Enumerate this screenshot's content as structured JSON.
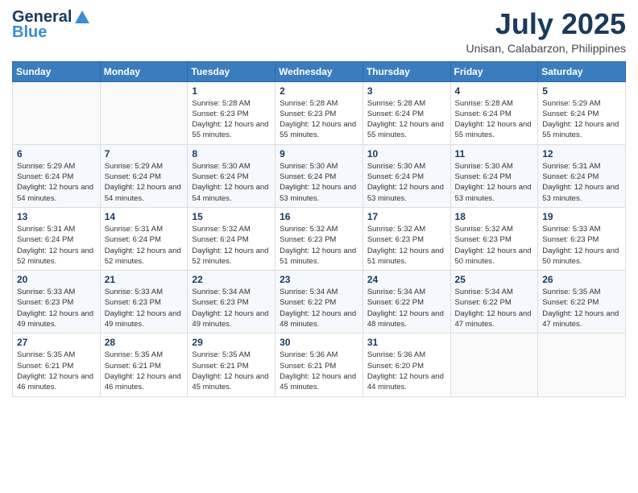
{
  "logo": {
    "general": "General",
    "blue": "Blue"
  },
  "header": {
    "month": "July 2025",
    "location": "Unisan, Calabarzon, Philippines"
  },
  "weekdays": [
    "Sunday",
    "Monday",
    "Tuesday",
    "Wednesday",
    "Thursday",
    "Friday",
    "Saturday"
  ],
  "weeks": [
    [
      {
        "day": "",
        "sunrise": "",
        "sunset": "",
        "daylight": ""
      },
      {
        "day": "",
        "sunrise": "",
        "sunset": "",
        "daylight": ""
      },
      {
        "day": "1",
        "sunrise": "Sunrise: 5:28 AM",
        "sunset": "Sunset: 6:23 PM",
        "daylight": "Daylight: 12 hours and 55 minutes."
      },
      {
        "day": "2",
        "sunrise": "Sunrise: 5:28 AM",
        "sunset": "Sunset: 6:23 PM",
        "daylight": "Daylight: 12 hours and 55 minutes."
      },
      {
        "day": "3",
        "sunrise": "Sunrise: 5:28 AM",
        "sunset": "Sunset: 6:24 PM",
        "daylight": "Daylight: 12 hours and 55 minutes."
      },
      {
        "day": "4",
        "sunrise": "Sunrise: 5:28 AM",
        "sunset": "Sunset: 6:24 PM",
        "daylight": "Daylight: 12 hours and 55 minutes."
      },
      {
        "day": "5",
        "sunrise": "Sunrise: 5:29 AM",
        "sunset": "Sunset: 6:24 PM",
        "daylight": "Daylight: 12 hours and 55 minutes."
      }
    ],
    [
      {
        "day": "6",
        "sunrise": "Sunrise: 5:29 AM",
        "sunset": "Sunset: 6:24 PM",
        "daylight": "Daylight: 12 hours and 54 minutes."
      },
      {
        "day": "7",
        "sunrise": "Sunrise: 5:29 AM",
        "sunset": "Sunset: 6:24 PM",
        "daylight": "Daylight: 12 hours and 54 minutes."
      },
      {
        "day": "8",
        "sunrise": "Sunrise: 5:30 AM",
        "sunset": "Sunset: 6:24 PM",
        "daylight": "Daylight: 12 hours and 54 minutes."
      },
      {
        "day": "9",
        "sunrise": "Sunrise: 5:30 AM",
        "sunset": "Sunset: 6:24 PM",
        "daylight": "Daylight: 12 hours and 53 minutes."
      },
      {
        "day": "10",
        "sunrise": "Sunrise: 5:30 AM",
        "sunset": "Sunset: 6:24 PM",
        "daylight": "Daylight: 12 hours and 53 minutes."
      },
      {
        "day": "11",
        "sunrise": "Sunrise: 5:30 AM",
        "sunset": "Sunset: 6:24 PM",
        "daylight": "Daylight: 12 hours and 53 minutes."
      },
      {
        "day": "12",
        "sunrise": "Sunrise: 5:31 AM",
        "sunset": "Sunset: 6:24 PM",
        "daylight": "Daylight: 12 hours and 53 minutes."
      }
    ],
    [
      {
        "day": "13",
        "sunrise": "Sunrise: 5:31 AM",
        "sunset": "Sunset: 6:24 PM",
        "daylight": "Daylight: 12 hours and 52 minutes."
      },
      {
        "day": "14",
        "sunrise": "Sunrise: 5:31 AM",
        "sunset": "Sunset: 6:24 PM",
        "daylight": "Daylight: 12 hours and 52 minutes."
      },
      {
        "day": "15",
        "sunrise": "Sunrise: 5:32 AM",
        "sunset": "Sunset: 6:24 PM",
        "daylight": "Daylight: 12 hours and 52 minutes."
      },
      {
        "day": "16",
        "sunrise": "Sunrise: 5:32 AM",
        "sunset": "Sunset: 6:23 PM",
        "daylight": "Daylight: 12 hours and 51 minutes."
      },
      {
        "day": "17",
        "sunrise": "Sunrise: 5:32 AM",
        "sunset": "Sunset: 6:23 PM",
        "daylight": "Daylight: 12 hours and 51 minutes."
      },
      {
        "day": "18",
        "sunrise": "Sunrise: 5:32 AM",
        "sunset": "Sunset: 6:23 PM",
        "daylight": "Daylight: 12 hours and 50 minutes."
      },
      {
        "day": "19",
        "sunrise": "Sunrise: 5:33 AM",
        "sunset": "Sunset: 6:23 PM",
        "daylight": "Daylight: 12 hours and 50 minutes."
      }
    ],
    [
      {
        "day": "20",
        "sunrise": "Sunrise: 5:33 AM",
        "sunset": "Sunset: 6:23 PM",
        "daylight": "Daylight: 12 hours and 49 minutes."
      },
      {
        "day": "21",
        "sunrise": "Sunrise: 5:33 AM",
        "sunset": "Sunset: 6:23 PM",
        "daylight": "Daylight: 12 hours and 49 minutes."
      },
      {
        "day": "22",
        "sunrise": "Sunrise: 5:34 AM",
        "sunset": "Sunset: 6:23 PM",
        "daylight": "Daylight: 12 hours and 49 minutes."
      },
      {
        "day": "23",
        "sunrise": "Sunrise: 5:34 AM",
        "sunset": "Sunset: 6:22 PM",
        "daylight": "Daylight: 12 hours and 48 minutes."
      },
      {
        "day": "24",
        "sunrise": "Sunrise: 5:34 AM",
        "sunset": "Sunset: 6:22 PM",
        "daylight": "Daylight: 12 hours and 48 minutes."
      },
      {
        "day": "25",
        "sunrise": "Sunrise: 5:34 AM",
        "sunset": "Sunset: 6:22 PM",
        "daylight": "Daylight: 12 hours and 47 minutes."
      },
      {
        "day": "26",
        "sunrise": "Sunrise: 5:35 AM",
        "sunset": "Sunset: 6:22 PM",
        "daylight": "Daylight: 12 hours and 47 minutes."
      }
    ],
    [
      {
        "day": "27",
        "sunrise": "Sunrise: 5:35 AM",
        "sunset": "Sunset: 6:21 PM",
        "daylight": "Daylight: 12 hours and 46 minutes."
      },
      {
        "day": "28",
        "sunrise": "Sunrise: 5:35 AM",
        "sunset": "Sunset: 6:21 PM",
        "daylight": "Daylight: 12 hours and 46 minutes."
      },
      {
        "day": "29",
        "sunrise": "Sunrise: 5:35 AM",
        "sunset": "Sunset: 6:21 PM",
        "daylight": "Daylight: 12 hours and 45 minutes."
      },
      {
        "day": "30",
        "sunrise": "Sunrise: 5:36 AM",
        "sunset": "Sunset: 6:21 PM",
        "daylight": "Daylight: 12 hours and 45 minutes."
      },
      {
        "day": "31",
        "sunrise": "Sunrise: 5:36 AM",
        "sunset": "Sunset: 6:20 PM",
        "daylight": "Daylight: 12 hours and 44 minutes."
      },
      {
        "day": "",
        "sunrise": "",
        "sunset": "",
        "daylight": ""
      },
      {
        "day": "",
        "sunrise": "",
        "sunset": "",
        "daylight": ""
      }
    ]
  ]
}
